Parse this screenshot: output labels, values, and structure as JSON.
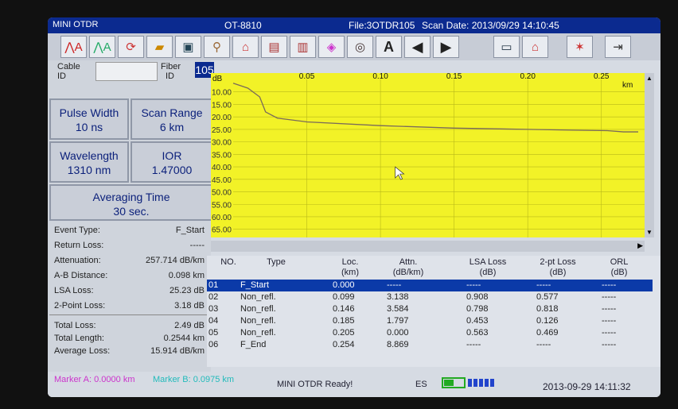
{
  "titlebar": {
    "app": "MINI OTDR",
    "model": "OT-8810",
    "file": "File:3OTDR105",
    "scan_date": "Scan Date: 2013/09/29 14:10:45"
  },
  "toolbar": {
    "text_button": "A"
  },
  "cable": {
    "cable_label": "Cable",
    "id_label": "ID",
    "cable_value": "",
    "fiber_label": "Fiber",
    "fiber_id_label": "ID",
    "fiber_value": "105"
  },
  "params": {
    "pulse_label": "Pulse Width",
    "pulse_value": "10 ns",
    "range_label": "Scan Range",
    "range_value": "6 km",
    "wavelength_label": "Wavelength",
    "wavelength_value": "1310 nm",
    "ior_label": "IOR",
    "ior_value": "1.47000",
    "avg_label": "Averaging Time",
    "avg_value": "30 sec."
  },
  "event_info": [
    {
      "label": "Event Type:",
      "value": "F_Start"
    },
    {
      "label": "Return Loss:",
      "value": "-----"
    },
    {
      "label": "Attenuation:",
      "value": "257.714 dB/km"
    },
    {
      "label": "A-B Distance:",
      "value": "0.098  km"
    },
    {
      "label": "LSA Loss:",
      "value": "25.23  dB"
    },
    {
      "label": "2-Point Loss:",
      "value": "3.18  dB"
    }
  ],
  "totals": [
    {
      "label": "Total Loss:",
      "value": "2.49  dB"
    },
    {
      "label": "Total Length:",
      "value": "0.2544  km"
    },
    {
      "label": "Average Loss:",
      "value": "15.914 dB/km"
    }
  ],
  "chart_data": {
    "type": "line",
    "xlabel": "km",
    "ylabel": "dB",
    "x_ticks": [
      "0.05",
      "0.10",
      "0.15",
      "0.20",
      "0.25"
    ],
    "y_ticks": [
      "10.00",
      "15.00",
      "20.00",
      "25.00",
      "30.00",
      "35.00",
      "40.00",
      "45.00",
      "50.00",
      "55.00",
      "60.00",
      "65.00"
    ],
    "xlim": [
      0,
      0.275
    ],
    "ylim": [
      5,
      67
    ],
    "grid": true,
    "background": "#f2f227",
    "trace_color": "#7a6a5a",
    "series": [
      {
        "x": [
          0.0,
          0.01,
          0.018,
          0.022,
          0.03,
          0.05,
          0.1,
          0.15,
          0.2,
          0.23,
          0.254,
          0.265,
          0.275
        ],
        "y": [
          6.5,
          8.5,
          12.0,
          18.0,
          20.5,
          22.0,
          23.5,
          24.5,
          25.0,
          25.3,
          25.5,
          26.0,
          26.0
        ]
      }
    ]
  },
  "table": {
    "headers": [
      "NO.",
      "Type",
      "Loc.\n(km)",
      "Attn.\n(dB/km)",
      "LSA Loss\n(dB)",
      "2-pt Loss\n(dB)",
      "ORL\n(dB)"
    ],
    "rows": [
      [
        "01",
        "F_Start",
        "0.000",
        "-----",
        "-----",
        "-----",
        "-----"
      ],
      [
        "02",
        "Non_refl.",
        "0.099",
        "3.138",
        "0.908",
        "0.577",
        "-----"
      ],
      [
        "03",
        "Non_refl.",
        "0.146",
        "3.584",
        "0.798",
        "0.818",
        "-----"
      ],
      [
        "04",
        "Non_refl.",
        "0.185",
        "1.797",
        "0.453",
        "0.126",
        "-----"
      ],
      [
        "05",
        "Non_refl.",
        "0.205",
        "0.000",
        "0.563",
        "0.469",
        "-----"
      ],
      [
        "06",
        "F_End",
        "0.254",
        "8.869",
        "-----",
        "-----",
        "-----"
      ]
    ]
  },
  "status": {
    "marker_a": "Marker A:  0.0000 km",
    "marker_b": "Marker B:  0.0975 km",
    "message": "MINI OTDR Ready!",
    "lang": "ES",
    "datetime": "2013-09-29   14:11:32",
    "battery_level": 0.5
  }
}
